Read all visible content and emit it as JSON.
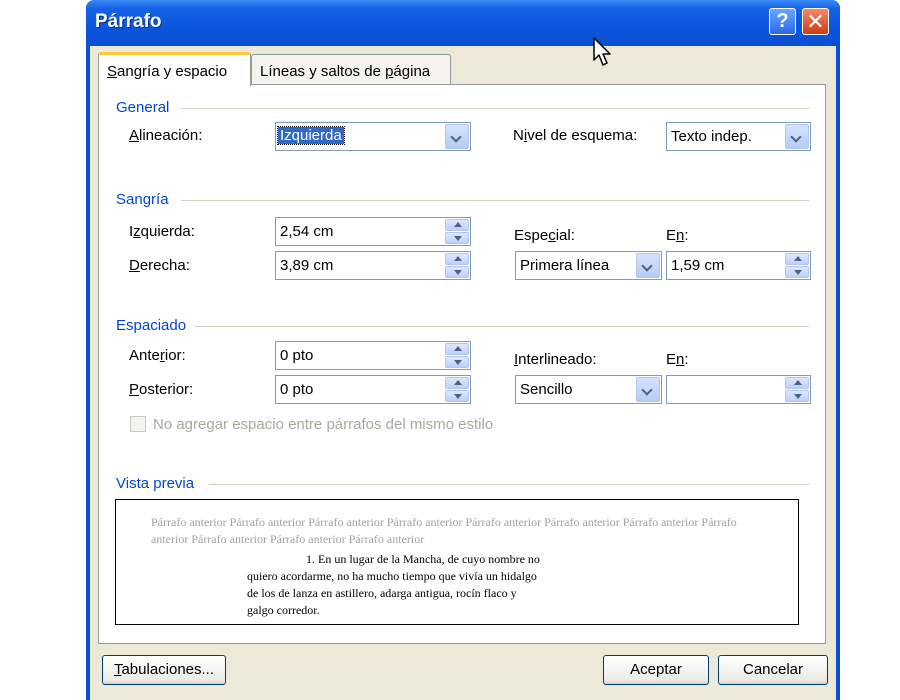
{
  "window": {
    "title": "Párrafo",
    "help_glyph": "?",
    "close_glyph": "✕"
  },
  "tabs": [
    {
      "pre": "",
      "key": "S",
      "post": "angría y espacio"
    },
    {
      "pre": "Líneas y saltos de ",
      "key": "p",
      "post": "ágina"
    }
  ],
  "general": {
    "heading": "General",
    "alignment": {
      "pre": "",
      "key": "A",
      "post": "lineación:",
      "value": "Izquierda"
    },
    "outline": {
      "pre": "N",
      "key": "i",
      "post": "vel de esquema:",
      "value": "Texto indep."
    }
  },
  "indent": {
    "heading": "Sangría",
    "left": {
      "pre": "I",
      "key": "z",
      "post": "quierda:",
      "value": "2,54 cm"
    },
    "right": {
      "pre": "",
      "key": "D",
      "post": "erecha:",
      "value": "3,89 cm"
    },
    "special": {
      "pre": "Espe",
      "key": "c",
      "post": "ial:",
      "value": "Primera línea"
    },
    "by": {
      "pre": "E",
      "key": "n",
      "post": ":",
      "value": "1,59 cm"
    }
  },
  "spacing": {
    "heading": "Espaciado",
    "before": {
      "pre": "Ante",
      "key": "r",
      "post": "ior:",
      "value": "0 pto"
    },
    "after": {
      "pre": "",
      "key": "P",
      "post": "osterior:",
      "value": "0 pto"
    },
    "line": {
      "pre": "",
      "key": "I",
      "post": "nterlineado:",
      "value": "Sencillo"
    },
    "at": {
      "pre": "E",
      "key": "n",
      "post": ":",
      "value": ""
    },
    "no_space_label": "No agregar espacio entre párrafos del mismo estilo"
  },
  "preview": {
    "heading": "Vista previa",
    "prev_text": "Párrafo anterior Párrafo anterior Párrafo anterior Párrafo anterior Párrafo anterior Párrafo anterior Párrafo anterior Párrafo anterior Párrafo anterior Párrafo anterior Párrafo anterior",
    "lines": [
      "1. En un lugar de la Mancha, de cuyo nombre no",
      "quiero acordarme, no ha mucho tiempo que vivía un hidalgo",
      "de los de lanza en astillero, adarga antigua, rocín flaco y",
      "galgo corredor."
    ]
  },
  "buttons": {
    "tabs": {
      "pre": "",
      "key": "T",
      "post": "abulaciones..."
    },
    "ok": "Aceptar",
    "cancel": "Cancelar"
  }
}
